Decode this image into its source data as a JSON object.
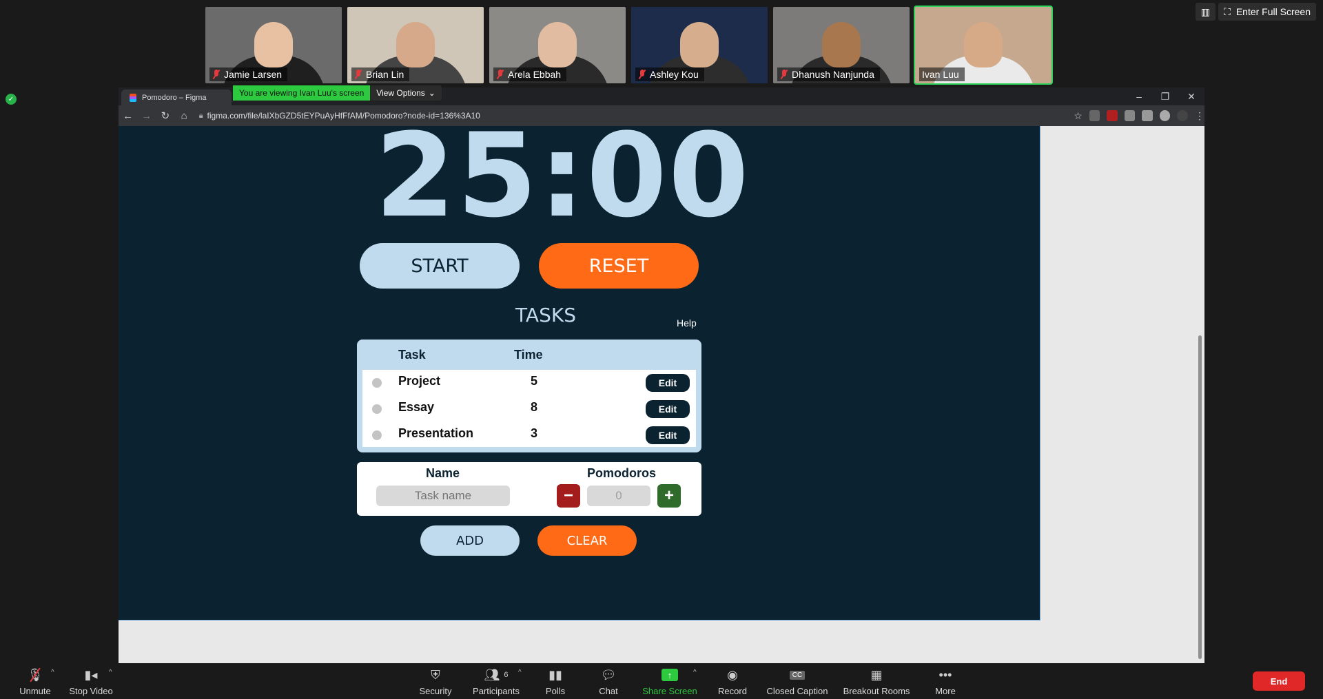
{
  "participants": [
    {
      "name": "Jamie Larsen",
      "bg": "#6b6b6b",
      "skin": "#e7c1a2",
      "shirt": "#1f1f1f",
      "muted": true
    },
    {
      "name": "Brian Lin",
      "bg": "#cfc6b8",
      "skin": "#d5a98a",
      "shirt": "#444",
      "muted": true
    },
    {
      "name": "Arela Ebbah",
      "bg": "#8c8a86",
      "skin": "#e2bca1",
      "shirt": "#2a2a2a",
      "muted": true
    },
    {
      "name": "Ashley Kou",
      "bg": "#1d2c4a",
      "skin": "#d7ae8d",
      "shirt": "#2d2d2d",
      "muted": true
    },
    {
      "name": "Dhanush Nanjunda",
      "bg": "#7d7b7a",
      "skin": "#a9774e",
      "shirt": "#2a2a2a",
      "muted": true
    },
    {
      "name": "Ivan Luu",
      "bg": "#c6a88e",
      "skin": "#d6a987",
      "shirt": "#eaeaea",
      "muted": false,
      "active": true
    }
  ],
  "top_controls": {
    "full_screen": "Enter Full Screen"
  },
  "share_banner": {
    "viewing": "You are viewing Ivan Luu's screen",
    "options": "View Options"
  },
  "browser": {
    "tab_title": "Pomodoro – Figma",
    "url": "figma.com/file/laIXbGZD5tEYPuAyHfFfAM/Pomodoro?node-id=136%3A10"
  },
  "pomodoro": {
    "timer": "25:00",
    "start": "START",
    "reset": "RESET",
    "tasks_title": "TASKS",
    "help": "Help",
    "columns": {
      "task": "Task",
      "time": "Time"
    },
    "tasks": [
      {
        "name": "Project",
        "time": "5",
        "edit": "Edit"
      },
      {
        "name": "Essay",
        "time": "8",
        "edit": "Edit"
      },
      {
        "name": "Presentation",
        "time": "3",
        "edit": "Edit"
      }
    ],
    "form": {
      "name_label": "Name",
      "pomodoros_label": "Pomodoros",
      "name_placeholder": "Task name",
      "pomodoros_value": "0",
      "minus": "−",
      "plus": "+"
    },
    "add": "ADD",
    "clear": "CLEAR"
  },
  "toolbar": {
    "unmute": "Unmute",
    "stop_video": "Stop Video",
    "security": "Security",
    "participants": "Participants",
    "participants_count": "6",
    "polls": "Polls",
    "chat": "Chat",
    "share_screen": "Share Screen",
    "record": "Record",
    "closed_caption": "Closed Caption",
    "breakout_rooms": "Breakout Rooms",
    "more": "More",
    "end": "End"
  },
  "colors": {
    "frame_bg": "#0b2231",
    "accent_light": "#c1dbee",
    "accent_orange": "#ff6a17",
    "zoom_green": "#2dc93f",
    "end_red": "#e02828"
  }
}
